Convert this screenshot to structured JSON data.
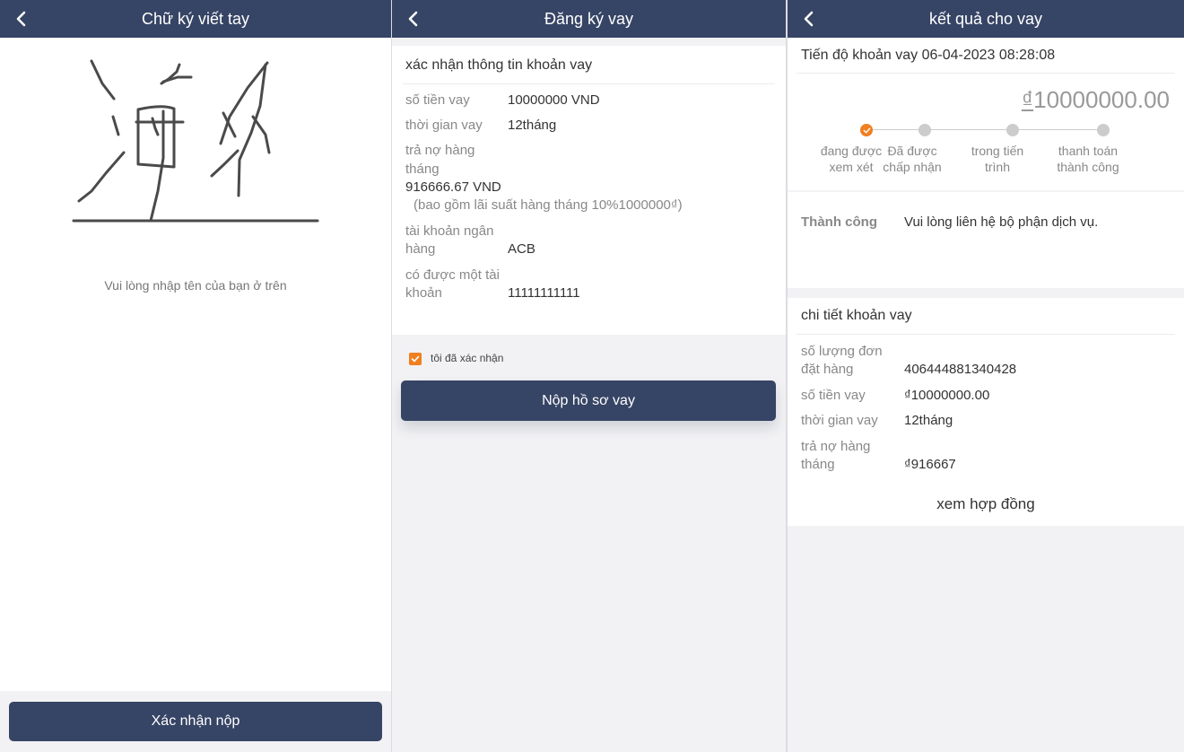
{
  "signature_screen": {
    "title": "Chữ ký viết tay",
    "hint": "Vui lòng nhập tên của bạn ở trên",
    "submit_label": "Xác nhận nộp"
  },
  "register_screen": {
    "title": "Đăng ký vay",
    "section_title": "xác nhận thông tin khoản vay",
    "loan_amount_label": "số tiền vay",
    "loan_amount_value": "10000000 VND",
    "term_label": "thời gian vay",
    "term_value": "12tháng",
    "monthly_label_line1": "trả nợ hàng",
    "monthly_label_line2": "tháng",
    "monthly_value": "916666.67 VND",
    "monthly_note": "(bao gồm lãi suất hàng tháng 10%1000000₫)",
    "bank_label_line1": "tài khoản ngân",
    "bank_label_line2": "hàng",
    "bank_value": "ACB",
    "account_label_line1": "có được một tài",
    "account_label_line2": "khoản",
    "account_value": "11111111111",
    "confirm_label": "tôi đã xác nhận",
    "confirm_checked": true,
    "submit_label": "Nộp hồ sơ vay"
  },
  "result_screen": {
    "title": "kết quả cho vay",
    "progress_title": "Tiến độ khoản vay 06-04-2023 08:28:08",
    "amount_currency": "₫",
    "amount_value": "10000000.00",
    "steps": [
      {
        "line1": "đang được",
        "line2": "xem xét",
        "active": true
      },
      {
        "line1": "Đã được",
        "line2": "chấp nhận",
        "active": false
      },
      {
        "line1": "trong tiến",
        "line2": "trình",
        "active": false
      },
      {
        "line1": "thanh toán",
        "line2": "thành công",
        "active": false
      }
    ],
    "status_title": "Thành công",
    "status_message": "Vui lòng liên hệ bộ phận dịch vụ.",
    "details_title": "chi tiết khoản vay",
    "order_label_line1": "số lượng đơn",
    "order_label_line2": "đặt hàng",
    "order_value": "406444881340428",
    "amount_label": "số tiền vay",
    "amount_detail_value": "₫10000000.00",
    "term_label": "thời gian vay",
    "term_value": "12tháng",
    "monthly_label_line1": "trả nợ hàng",
    "monthly_label_line2": "tháng",
    "monthly_value": "₫916667",
    "contract_link": "xem hợp đồng"
  },
  "colors": {
    "header": "#364465",
    "accent": "#f07f1f",
    "background": "#f2f2f4"
  }
}
